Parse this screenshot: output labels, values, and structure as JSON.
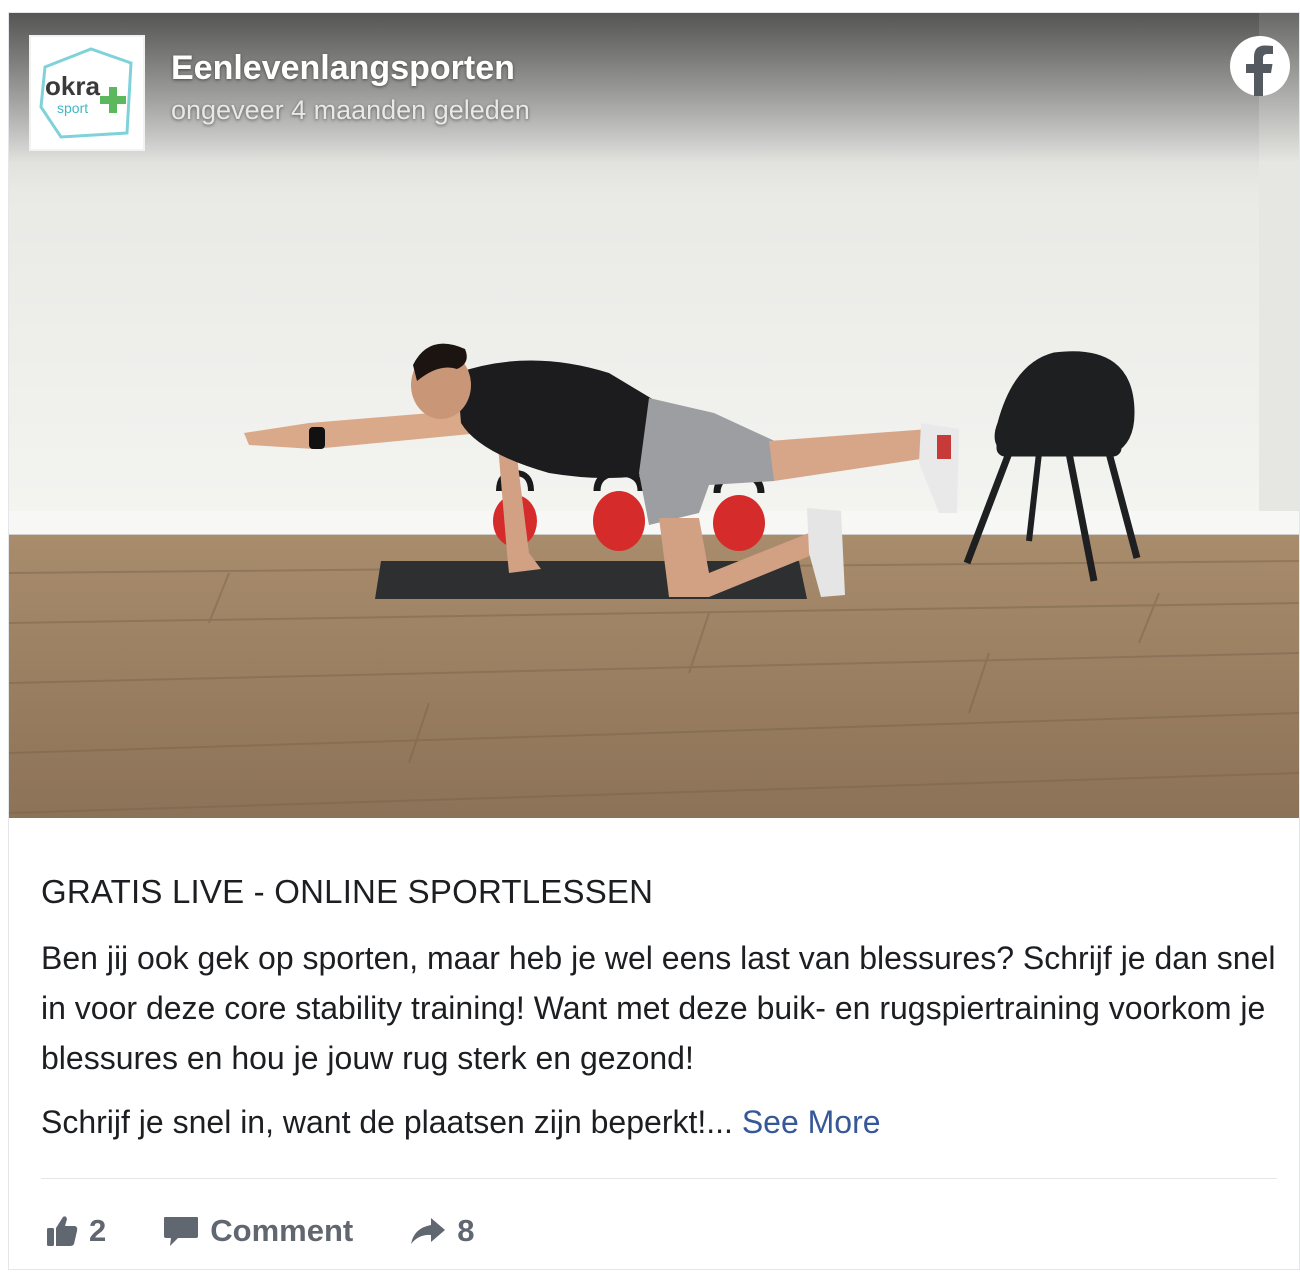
{
  "post": {
    "page_name": "Eenlevenlangsporten",
    "time": "ongeveer 4 maanden geleden",
    "avatar_logo_text": "okra sport",
    "avatar_icon": "okra-sport-logo",
    "platform_icon": "facebook-icon",
    "media_description_icon": "exercise-video-thumbnail",
    "title": "GRATIS LIVE - ONLINE SPORTLESSEN",
    "body_paragraph_1": "Ben jij ook gek op sporten, maar heb je wel eens last van blessures? Schrijf je dan snel in voor deze core stability training! Want met deze buik- en rugspiertraining voorkom je blessures en hou je jouw rug sterk en gezond!",
    "body_paragraph_2": "Schrijf je snel in, want de plaatsen zijn beperkt!...",
    "see_more": "See More"
  },
  "actions": {
    "like_count": "2",
    "comment_label": "Comment",
    "share_count": "8"
  },
  "colors": {
    "link": "#365899",
    "action_grey": "#606770",
    "facebook_white": "#ffffff",
    "okra_teal": "#3fb9c6",
    "okra_green": "#5cb85c"
  }
}
